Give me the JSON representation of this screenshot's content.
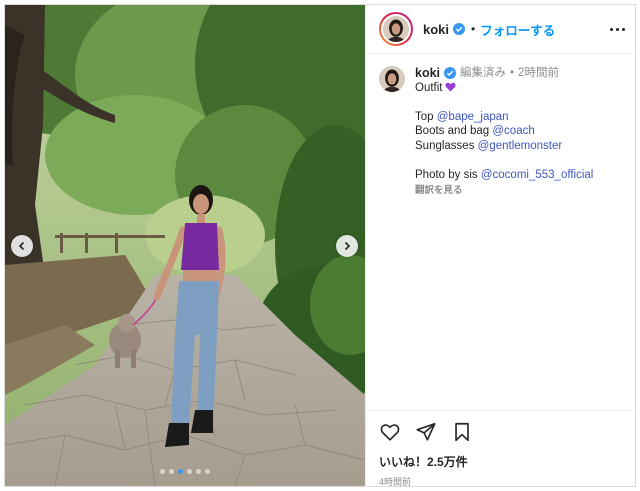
{
  "post": {
    "author": {
      "username": "koki",
      "follow_label": "フォローする",
      "separator": "•"
    },
    "caption": {
      "username": "koki",
      "edited_label": "編集済み",
      "separator": "•",
      "time_ago": "2時間前",
      "line1_text": "Outfit",
      "line1_emoji": "purple-heart",
      "top_label": "Top",
      "top_mention": "@bape_japan",
      "boots_label": "Boots and bag",
      "boots_mention": "@coach",
      "sunglasses_label": "Sunglasses",
      "sunglasses_mention": "@gentlemonster",
      "photo_label": "Photo by sis",
      "photo_mention": "@cocomi_553_official",
      "translate_label": "翻訳を見る"
    },
    "likes_label": "いいね！2.5万件",
    "posted_time": "4時間前",
    "carousel": {
      "total": 6,
      "active_index": 2
    },
    "colors": {
      "accent": "#0095f6",
      "mention": "#4056c0",
      "verified": "#3897f0",
      "heart": "#8e44ad"
    }
  }
}
